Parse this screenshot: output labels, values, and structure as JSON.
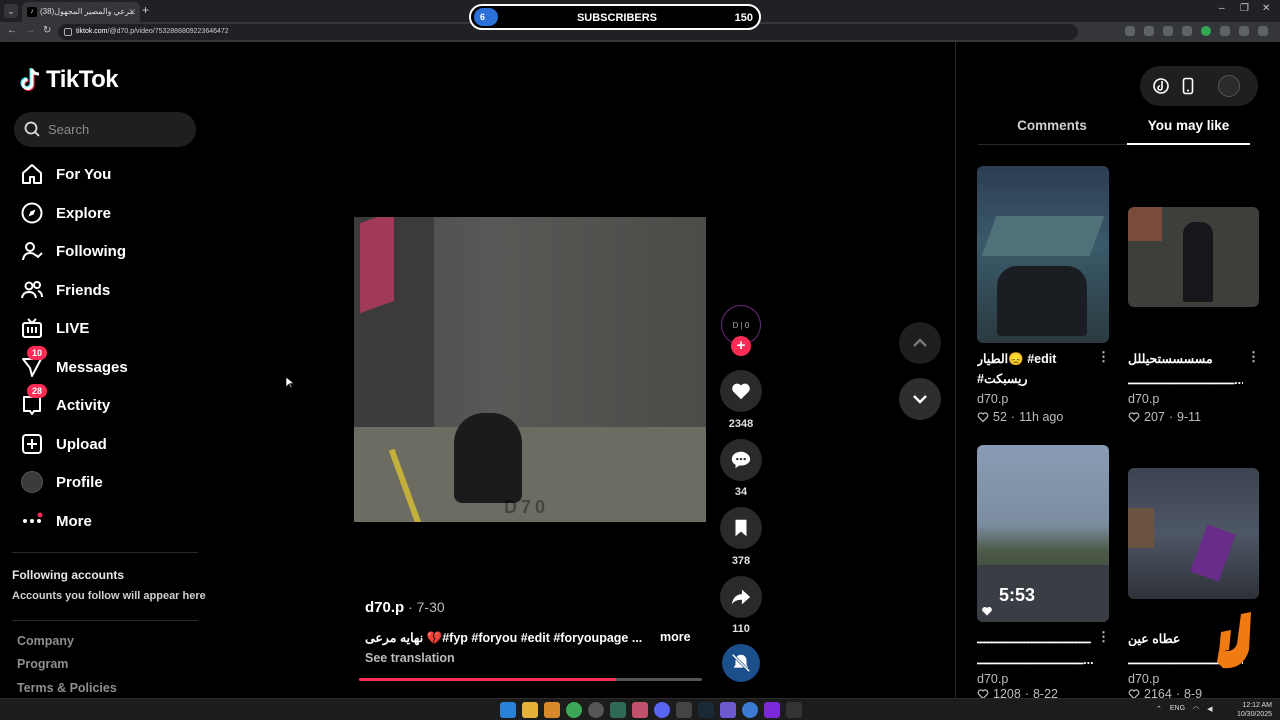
{
  "browser": {
    "tab_title": "(38)مرعي والمصير المجهول",
    "url_domain": "tiktok.com",
    "url_path": "/@d70.p/video/7532886809223646472",
    "new_tab": "+",
    "minimize": "–",
    "restore": "❐",
    "close": "✕"
  },
  "overlay": {
    "left_value": "6",
    "label": "SUBSCRIBERS",
    "count": "150"
  },
  "sidebar": {
    "logo_text": "TikTok",
    "search_placeholder": "Search",
    "items": [
      {
        "label": "For You",
        "icon": "home-icon"
      },
      {
        "label": "Explore",
        "icon": "compass-icon"
      },
      {
        "label": "Following",
        "icon": "following-icon"
      },
      {
        "label": "Friends",
        "icon": "friends-icon"
      },
      {
        "label": "LIVE",
        "icon": "live-icon"
      },
      {
        "label": "Messages",
        "icon": "messages-icon",
        "badge": "10"
      },
      {
        "label": "Activity",
        "icon": "activity-icon",
        "badge": "28"
      },
      {
        "label": "Upload",
        "icon": "upload-icon"
      },
      {
        "label": "Profile",
        "icon": "avatar"
      },
      {
        "label": "More",
        "icon": "more-icon"
      }
    ],
    "following_title": "Following accounts",
    "following_subtitle": "Accounts you follow will appear here",
    "footer": [
      "Company",
      "Program",
      "Terms & Policies"
    ]
  },
  "video": {
    "watermark": "D70",
    "author": "d70.p",
    "date": " · 7-30",
    "caption": "نهايه مرعى 💔#fyp #foryou #edit #foryoupage ...",
    "more": "more",
    "translate": "See translation",
    "progress": 0.75
  },
  "actions": {
    "creator_initials": "D | 0",
    "follow": "+",
    "likes": "2348",
    "comments": "34",
    "saves": "378",
    "shares": "110"
  },
  "right_panel": {
    "tabs": [
      "Comments",
      "You may like"
    ],
    "active_tab": 1,
    "cards": [
      {
        "title": "الطيار😞 #edit",
        "title2": "#ريسبكت",
        "author": "d70.p",
        "likes": "52",
        "age": "11h ago"
      },
      {
        "title": "مسسسستحيللل",
        "title2": "ـــــــــــــــــــــــــــــ...",
        "author": "d70.p",
        "likes": "207",
        "age": "9-11"
      },
      {
        "title": "ـــــــــــــــــــــــــــــــ",
        "title2": "ـــــــــــــــــــــــــــــ...",
        "author": "d70.p",
        "likes": "1208",
        "age": "8-22",
        "overlay_text": "5:53"
      },
      {
        "title": "عطاه عين",
        "title2": "ـــــــــــــــــــــــــــــ...",
        "author": "d70.p",
        "likes": "2164",
        "age": "8-9"
      }
    ]
  },
  "taskbar": {
    "lang": "ENG",
    "time": "12:12 AM",
    "date": "10/30/2025"
  },
  "colors": {
    "accent": "#fe2c55",
    "background": "#000000",
    "panel": "#1f1f1f"
  }
}
